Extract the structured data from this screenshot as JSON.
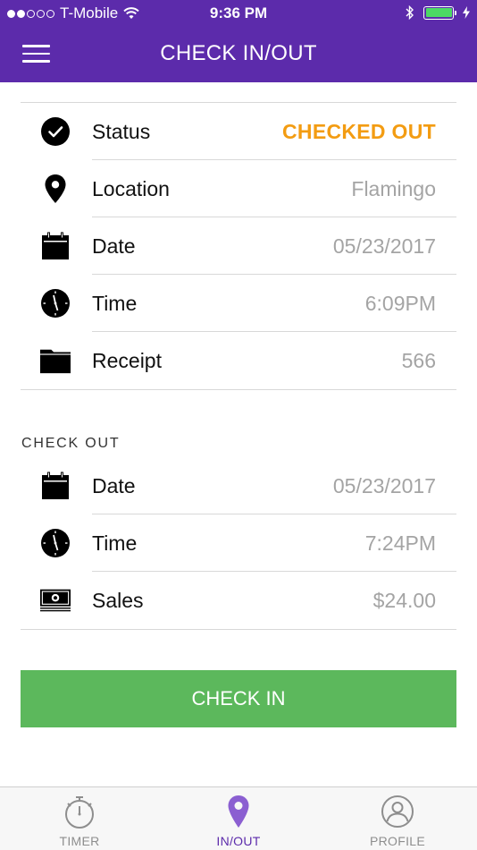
{
  "colors": {
    "brand": "#5c2bab",
    "accent": "#f39c12",
    "green": "#5cb85c",
    "tab_active_icon": "#8b5fd1"
  },
  "status_bar": {
    "carrier": "T-Mobile",
    "time": "9:36 PM"
  },
  "nav": {
    "title": "CHECK IN/OUT",
    "menu_icon": "hamburger-menu-icon"
  },
  "check_in": {
    "rows": [
      {
        "icon": "checkmark-circle-icon",
        "label": "Status",
        "value": "CHECKED OUT"
      },
      {
        "icon": "location-pin-icon",
        "label": "Location",
        "value": "Flamingo"
      },
      {
        "icon": "calendar-icon",
        "label": "Date",
        "value": "05/23/2017"
      },
      {
        "icon": "clock-icon",
        "label": "Time",
        "value": "6:09PM"
      },
      {
        "icon": "folder-icon",
        "label": "Receipt",
        "value": "566"
      }
    ]
  },
  "check_out": {
    "title": "CHECK OUT",
    "rows": [
      {
        "icon": "calendar-icon",
        "label": "Date",
        "value": "05/23/2017"
      },
      {
        "icon": "clock-icon",
        "label": "Time",
        "value": "7:24PM"
      },
      {
        "icon": "cash-icon",
        "label": "Sales",
        "value": "$24.00"
      }
    ]
  },
  "action_button": {
    "label": "CHECK IN"
  },
  "tabs": [
    {
      "label": "TIMER",
      "icon": "stopwatch-icon",
      "active": false
    },
    {
      "label": "IN/OUT",
      "icon": "location-pin-icon",
      "active": true
    },
    {
      "label": "PROFILE",
      "icon": "user-profile-icon",
      "active": false
    }
  ]
}
